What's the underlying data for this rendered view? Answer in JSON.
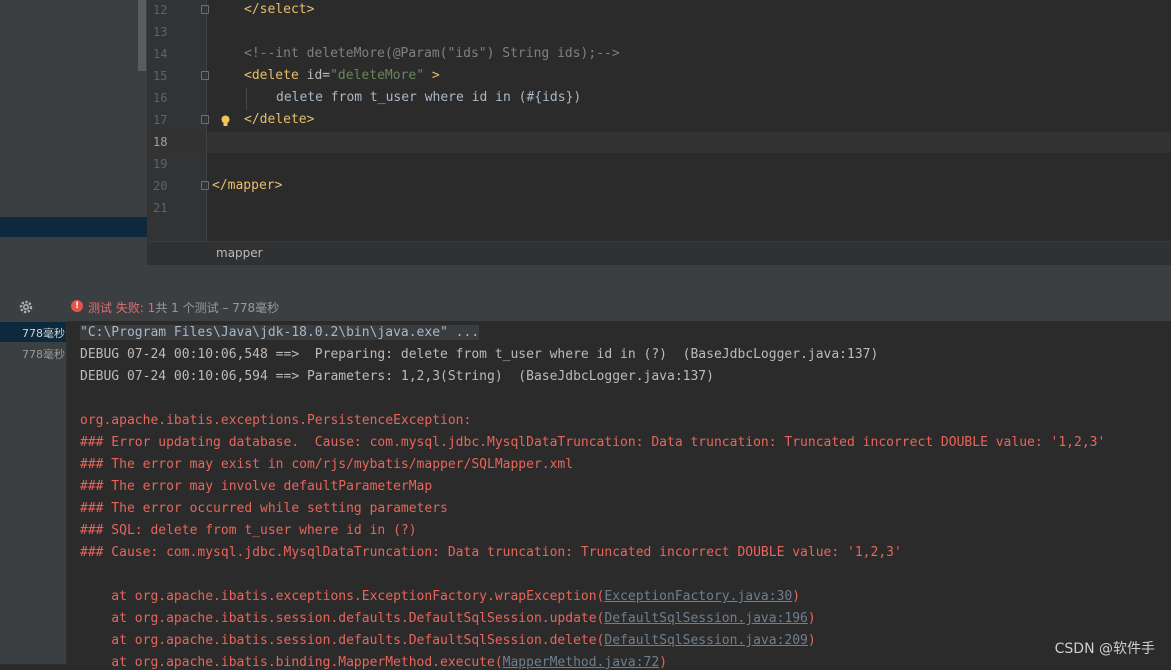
{
  "editor": {
    "lines": [
      {
        "num": "12",
        "code": "</select>"
      },
      {
        "num": "13",
        "code": ""
      },
      {
        "num": "14",
        "code": "<!--int deleteMore(@Param(\"ids\") String ids);-->"
      },
      {
        "num": "15",
        "code_tag": "<delete ",
        "code_attr": "id=",
        "code_str": "\"deleteMore\"",
        "code_end": " >"
      },
      {
        "num": "16",
        "code": "delete from t_user where id in (#{ids})"
      },
      {
        "num": "17",
        "code": "</delete>"
      },
      {
        "num": "18",
        "code": ""
      },
      {
        "num": "19",
        "code": ""
      },
      {
        "num": "20",
        "code": "</mapper>"
      },
      {
        "num": "21",
        "code": ""
      }
    ],
    "current_line": "18",
    "breadcrumb": "mapper"
  },
  "run": {
    "status_icon": "error-icon",
    "status_fail": "测试 失败: 1",
    "status_rest": "共 1 个测试 – 778毫秒",
    "tree": [
      {
        "label": "778毫秒"
      },
      {
        "label": "778毫秒"
      }
    ]
  },
  "console": {
    "lines": [
      {
        "text": "\"C:\\Program Files\\Java\\jdk-18.0.2\\bin\\java.exe\" ...",
        "kind": "cmd"
      },
      {
        "text": "DEBUG 07-24 00:10:06,548 ==>  Preparing: delete from t_user where id in (?)  (BaseJdbcLogger.java:137)",
        "kind": "debug"
      },
      {
        "text": "DEBUG 07-24 00:10:06,594 ==> Parameters: 1,2,3(String)  (BaseJdbcLogger.java:137)",
        "kind": "debug"
      },
      {
        "text": "",
        "kind": "blank"
      },
      {
        "text": "org.apache.ibatis.exceptions.PersistenceException: ",
        "kind": "error"
      },
      {
        "text": "### Error updating database.  Cause: com.mysql.jdbc.MysqlDataTruncation: Data truncation: Truncated incorrect DOUBLE value: '1,2,3'",
        "kind": "error"
      },
      {
        "text": "### The error may exist in com/rjs/mybatis/mapper/SQLMapper.xml",
        "kind": "error"
      },
      {
        "text": "### The error may involve defaultParameterMap",
        "kind": "error"
      },
      {
        "text": "### The error occurred while setting parameters",
        "kind": "error"
      },
      {
        "text": "### SQL: delete from t_user where id in (?)",
        "kind": "error"
      },
      {
        "text": "### Cause: com.mysql.jdbc.MysqlDataTruncation: Data truncation: Truncated incorrect DOUBLE value: '1,2,3'",
        "kind": "error"
      }
    ],
    "stack": [
      {
        "prefix": "    at org.apache.ibatis.exceptions.ExceptionFactory.wrapException(",
        "link": "ExceptionFactory.java:30",
        "suffix": ")"
      },
      {
        "prefix": "    at org.apache.ibatis.session.defaults.DefaultSqlSession.update(",
        "link": "DefaultSqlSession.java:196",
        "suffix": ")"
      },
      {
        "prefix": "    at org.apache.ibatis.session.defaults.DefaultSqlSession.delete(",
        "link": "DefaultSqlSession.java:209",
        "suffix": ")"
      },
      {
        "prefix": "    at org.apache.ibatis.binding.MapperMethod.execute(",
        "link": "MapperMethod.java:72",
        "suffix": ")"
      }
    ]
  },
  "watermark": "CSDN @软件手",
  "colors": {
    "tag": "#e8bf6a",
    "string": "#6a8759",
    "comment": "#808080",
    "error": "#e8655a",
    "background": "#2b2b2b",
    "panel": "#3c3f41"
  }
}
